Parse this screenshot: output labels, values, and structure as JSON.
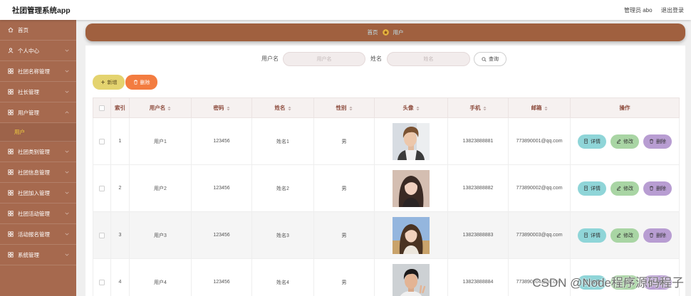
{
  "app": {
    "title": "社团管理系统app"
  },
  "header": {
    "user": "管理员 abo",
    "logout": "退出登录"
  },
  "sidebar": {
    "items": [
      {
        "label": "首页",
        "icon": "home-icon"
      },
      {
        "label": "个人中心",
        "icon": "person-icon",
        "chevron": "chevron-down-icon"
      },
      {
        "label": "社团名称管理",
        "icon": "grid-icon",
        "chevron": "chevron-down-icon"
      },
      {
        "label": "社长管理",
        "icon": "grid-icon",
        "chevron": "chevron-down-icon"
      },
      {
        "label": "用户管理",
        "icon": "grid-icon",
        "chevron": "chevron-up-icon",
        "expanded": true,
        "children": [
          {
            "label": "用户",
            "active": true
          }
        ]
      },
      {
        "label": "社团类别管理",
        "icon": "grid-icon",
        "chevron": "chevron-down-icon"
      },
      {
        "label": "社团信息管理",
        "icon": "grid-icon",
        "chevron": "chevron-down-icon"
      },
      {
        "label": "社团加入管理",
        "icon": "grid-icon",
        "chevron": "chevron-down-icon"
      },
      {
        "label": "社团活动管理",
        "icon": "grid-icon",
        "chevron": "chevron-down-icon"
      },
      {
        "label": "活动报名管理",
        "icon": "grid-icon",
        "chevron": "chevron-down-icon"
      },
      {
        "label": "系统管理",
        "icon": "grid-icon",
        "chevron": "chevron-down-icon"
      }
    ]
  },
  "breadcrumb": {
    "home": "首页",
    "current": "用户",
    "separator_icon": "star-icon"
  },
  "search": {
    "fields": [
      {
        "label": "用户名",
        "placeholder": "用户名",
        "value": ""
      },
      {
        "label": "姓名",
        "placeholder": "姓名",
        "value": ""
      }
    ],
    "button": "查询",
    "button_icon": "search-icon"
  },
  "toolbar": {
    "add": "新增",
    "add_icon": "plus-icon",
    "delete": "删除",
    "delete_icon": "trash-icon"
  },
  "table": {
    "columns": [
      {
        "label": "索引",
        "sortable": false
      },
      {
        "label": "用户名",
        "sortable": true
      },
      {
        "label": "密码",
        "sortable": true
      },
      {
        "label": "姓名",
        "sortable": true
      },
      {
        "label": "性别",
        "sortable": true
      },
      {
        "label": "头像",
        "sortable": true
      },
      {
        "label": "手机",
        "sortable": true
      },
      {
        "label": "邮箱",
        "sortable": true
      },
      {
        "label": "操作",
        "sortable": false
      }
    ],
    "rows": [
      {
        "index": "1",
        "username": "用户1",
        "password": "123456",
        "name": "姓名1",
        "gender": "男",
        "phone": "13823888881",
        "email": "773890001@qq.com"
      },
      {
        "index": "2",
        "username": "用户2",
        "password": "123456",
        "name": "姓名2",
        "gender": "男",
        "phone": "13823888882",
        "email": "773890002@qq.com"
      },
      {
        "index": "3",
        "username": "用户3",
        "password": "123456",
        "name": "姓名3",
        "gender": "男",
        "phone": "13823888883",
        "email": "773890003@qq.com"
      },
      {
        "index": "4",
        "username": "用户4",
        "password": "123456",
        "name": "姓名4",
        "gender": "男",
        "phone": "13823888884",
        "email": "773890004@qq.com"
      }
    ],
    "actions": {
      "detail": "详情",
      "edit": "修改",
      "delete": "删除"
    }
  },
  "watermark": {
    "text": "CSDN @Node程序源码程子"
  },
  "colors": {
    "sidebar_bg": "#a6694e",
    "breadcrumb_bg": "#a0603f",
    "breadcrumb_text": "#bfe2ee",
    "active_submenu_text": "#f3d13c",
    "add_button": "#e4d36f",
    "delete_button": "#f37c40",
    "detail_button": "#8fd5d8",
    "edit_button": "#a9d5a4",
    "row_delete_button": "#b89dd2",
    "table_header_bg": "#f6f1f0",
    "table_header_text": "#8c4a3b",
    "row_hover_bg": "#f5f5f5"
  }
}
